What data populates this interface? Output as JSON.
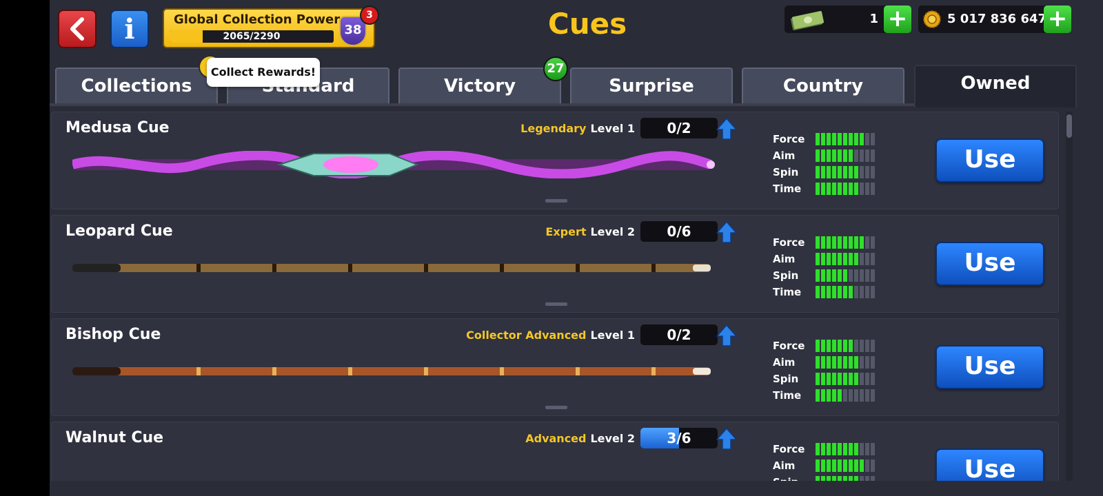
{
  "header": {
    "title": "Cues",
    "power": {
      "label": "Global Collection Power",
      "progress_text": "2065/2290",
      "progress_fraction": 0.2,
      "level": "38",
      "notification_count": "3"
    },
    "cash": {
      "value": "1"
    },
    "coins": {
      "value": "5 017 836 647"
    }
  },
  "tabs": [
    {
      "label": "Collections",
      "active": false
    },
    {
      "label": "Standard",
      "active": false
    },
    {
      "label": "Victory",
      "active": false,
      "badge": "27"
    },
    {
      "label": "Surprise",
      "active": false
    },
    {
      "label": "Country",
      "active": false
    },
    {
      "label": "Owned",
      "active": true
    }
  ],
  "tooltip": {
    "text": "Collect Rewards!"
  },
  "stat_labels": [
    "Force",
    "Aim",
    "Spin",
    "Time"
  ],
  "cues": [
    {
      "name": "Medusa Cue",
      "rarity": "Legendary",
      "level": "Level 1",
      "progress": "0/2",
      "progress_fraction": 0.0,
      "stats": {
        "force": 9,
        "aim": 7,
        "spin": 8,
        "time": 8
      },
      "use_label": "Use"
    },
    {
      "name": "Leopard Cue",
      "rarity": "Expert",
      "level": "Level 2",
      "progress": "0/6",
      "progress_fraction": 0.0,
      "stats": {
        "force": 9,
        "aim": 8,
        "spin": 6,
        "time": 7
      },
      "use_label": "Use"
    },
    {
      "name": "Bishop Cue",
      "rarity": "Collector Advanced",
      "level": "Level 1",
      "progress": "0/2",
      "progress_fraction": 0.0,
      "stats": {
        "force": 7,
        "aim": 8,
        "spin": 8,
        "time": 5
      },
      "use_label": "Use"
    },
    {
      "name": "Walnut Cue",
      "rarity": "Advanced",
      "level": "Level 2",
      "progress": "3/6",
      "progress_fraction": 0.5,
      "stats": {
        "force": 8,
        "aim": 9,
        "spin": 8,
        "time": 7
      },
      "use_label": "Use"
    }
  ],
  "stat_max": 11,
  "colors": {
    "accent_title": "#f9c51d",
    "rarity": "#f4c726",
    "stat_on": "#2ee02a",
    "use_button": "#1a63d4"
  }
}
